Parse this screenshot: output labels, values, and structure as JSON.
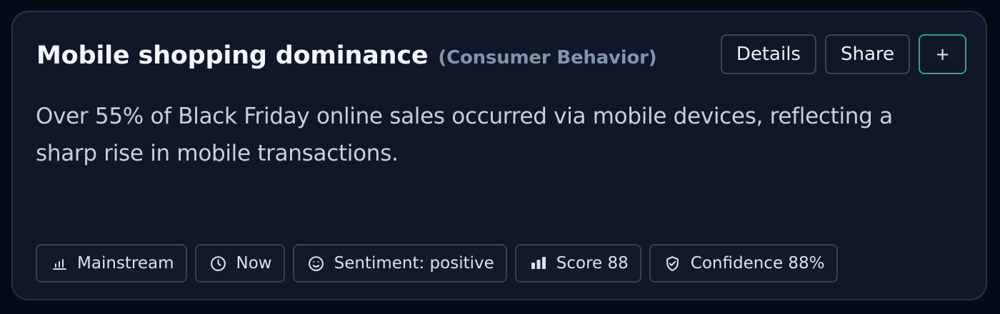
{
  "card": {
    "title": "Mobile shopping dominance",
    "category": "(Consumer Behavior)",
    "description": "Over 55% of Black Friday online sales occurred via mobile devices, reflecting a sharp rise in mobile transactions."
  },
  "actions": {
    "details_label": "Details",
    "share_label": "Share",
    "add_label": "+"
  },
  "tags": [
    {
      "icon": "bar-chart-icon",
      "label": "Mainstream"
    },
    {
      "icon": "clock-icon",
      "label": "Now"
    },
    {
      "icon": "smile-icon",
      "label": "Sentiment: positive"
    },
    {
      "icon": "score-bars-icon",
      "label": "Score 88"
    },
    {
      "icon": "shield-check-icon",
      "label": "Confidence 88%"
    }
  ],
  "colors": {
    "background": "#050a17",
    "card": "#0f1729",
    "accent": "#2ea485",
    "text": "#f3f6fa",
    "muted": "#8494aa"
  }
}
